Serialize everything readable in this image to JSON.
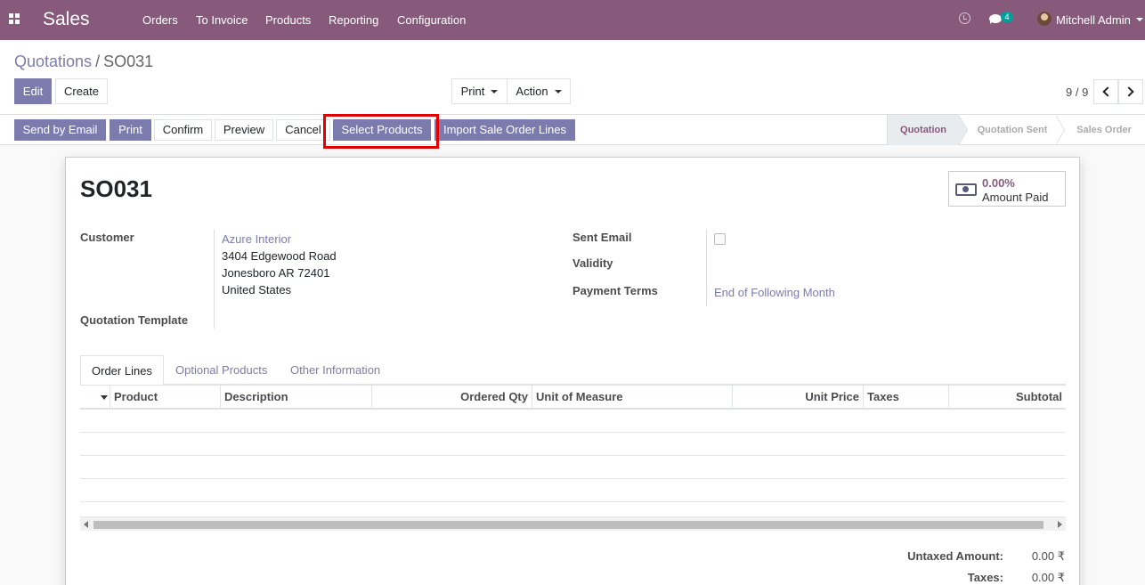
{
  "navbar": {
    "app_name": "Sales",
    "menu": [
      "Orders",
      "To Invoice",
      "Products",
      "Reporting",
      "Configuration"
    ],
    "messages_count": "4",
    "user_name": "Mitchell Admin",
    "color": "#875a7b"
  },
  "breadcrumb": {
    "parent": "Quotations",
    "separator": "/",
    "current": "SO031"
  },
  "control": {
    "edit": "Edit",
    "create": "Create",
    "print": "Print",
    "action": "Action",
    "pager": "9 / 9"
  },
  "statusbar": {
    "buttons": [
      "Send by Email",
      "Print",
      "Confirm",
      "Preview",
      "Cancel",
      "Select Products",
      "Import Sale Order Lines"
    ],
    "stages": [
      "Quotation",
      "Quotation Sent",
      "Sales Order"
    ],
    "active_stage": "Quotation"
  },
  "form": {
    "name": "SO031",
    "stat_amount_paid": {
      "value": "0.00%",
      "label": "Amount Paid"
    },
    "customer_label": "Customer",
    "customer_name": "Azure Interior",
    "address_lines": [
      "3404 Edgewood Road",
      "Jonesboro AR 72401",
      "United States"
    ],
    "quotation_template_label": "Quotation Template",
    "sent_email_label": "Sent Email",
    "validity_label": "Validity",
    "payment_terms_label": "Payment Terms",
    "payment_terms_value": "End of Following Month"
  },
  "tabs": [
    "Order Lines",
    "Optional Products",
    "Other Information"
  ],
  "table": {
    "columns": [
      "Product",
      "Description",
      "Ordered Qty",
      "Unit of Measure",
      "Unit Price",
      "Taxes",
      "Subtotal"
    ]
  },
  "totals": {
    "untaxed_label": "Untaxed Amount:",
    "untaxed_value": "0.00 ₹",
    "taxes_label": "Taxes:",
    "taxes_value": "0.00 ₹"
  }
}
